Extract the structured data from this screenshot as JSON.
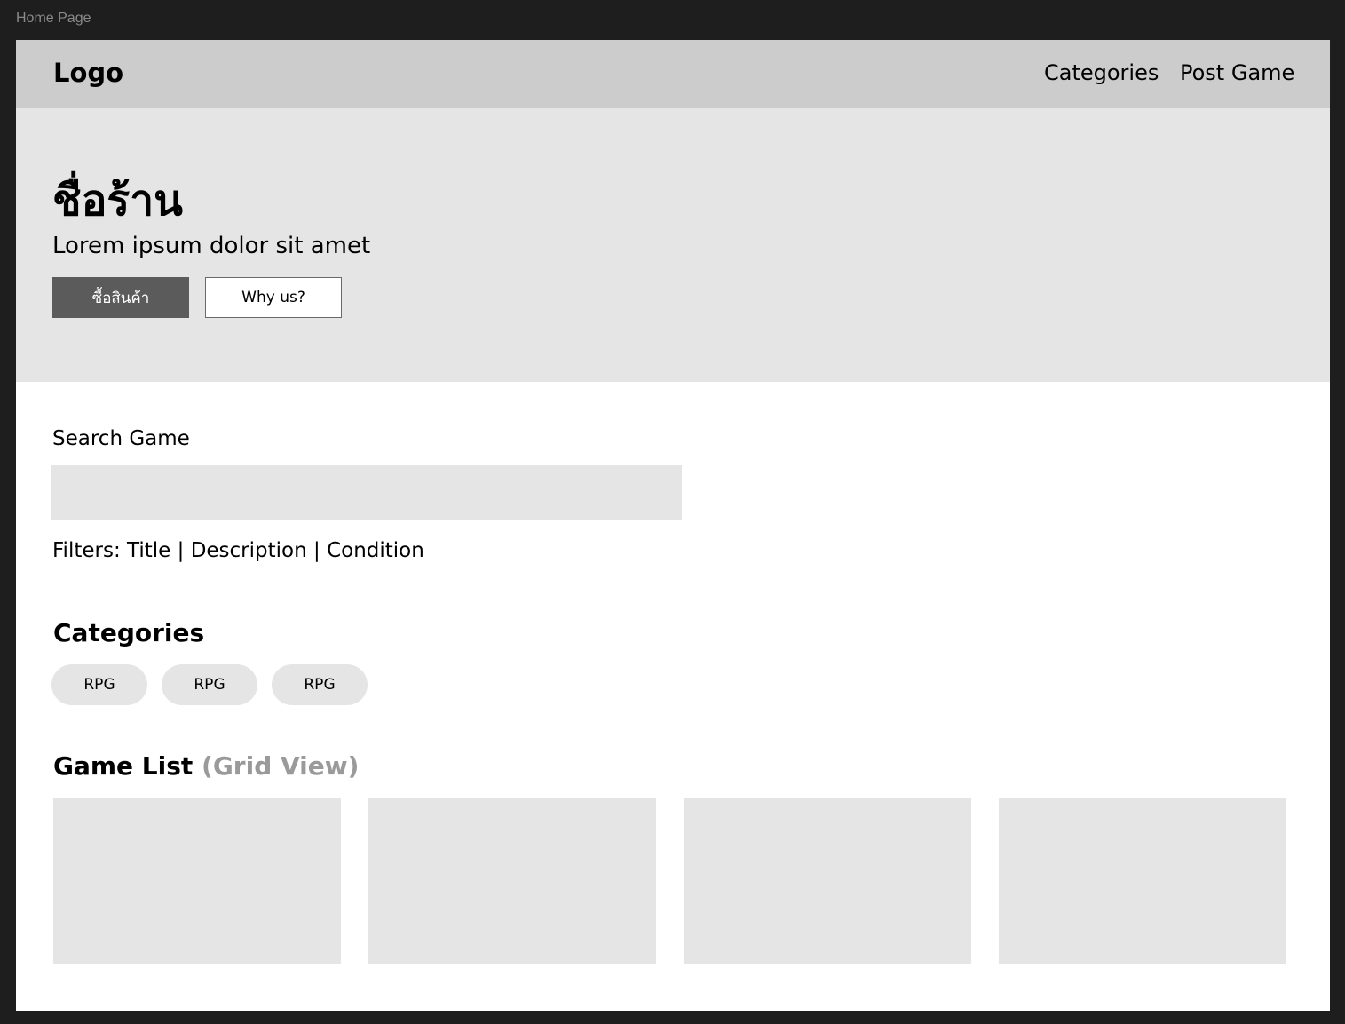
{
  "frame_label": "Home Page",
  "navbar": {
    "logo": "Logo",
    "links": [
      "Categories",
      "Post Game"
    ]
  },
  "hero": {
    "title": "ชื่อร้าน",
    "subtitle": "Lorem ipsum dolor sit amet",
    "primary_button": "ซื้อสินค้า",
    "secondary_button": "Why us?"
  },
  "search": {
    "label": "Search Game",
    "value": "",
    "placeholder": "",
    "filters_prefix": "Filters:",
    "filters": [
      "Title",
      "Description",
      "Condition"
    ],
    "separator": "|"
  },
  "categories": {
    "heading": "Categories",
    "items": [
      "RPG",
      "RPG",
      "RPG"
    ]
  },
  "game_list": {
    "heading": "Game List",
    "heading_note": "(Grid View)",
    "card_count_visible": 4
  },
  "colors": {
    "canvas": "#1e1e1e",
    "navbar": "#cccccc",
    "hero": "#e5e5e5",
    "placeholder": "#e5e5e5",
    "primary_button": "#5b5b5b",
    "muted_text": "#9a9a9a"
  }
}
